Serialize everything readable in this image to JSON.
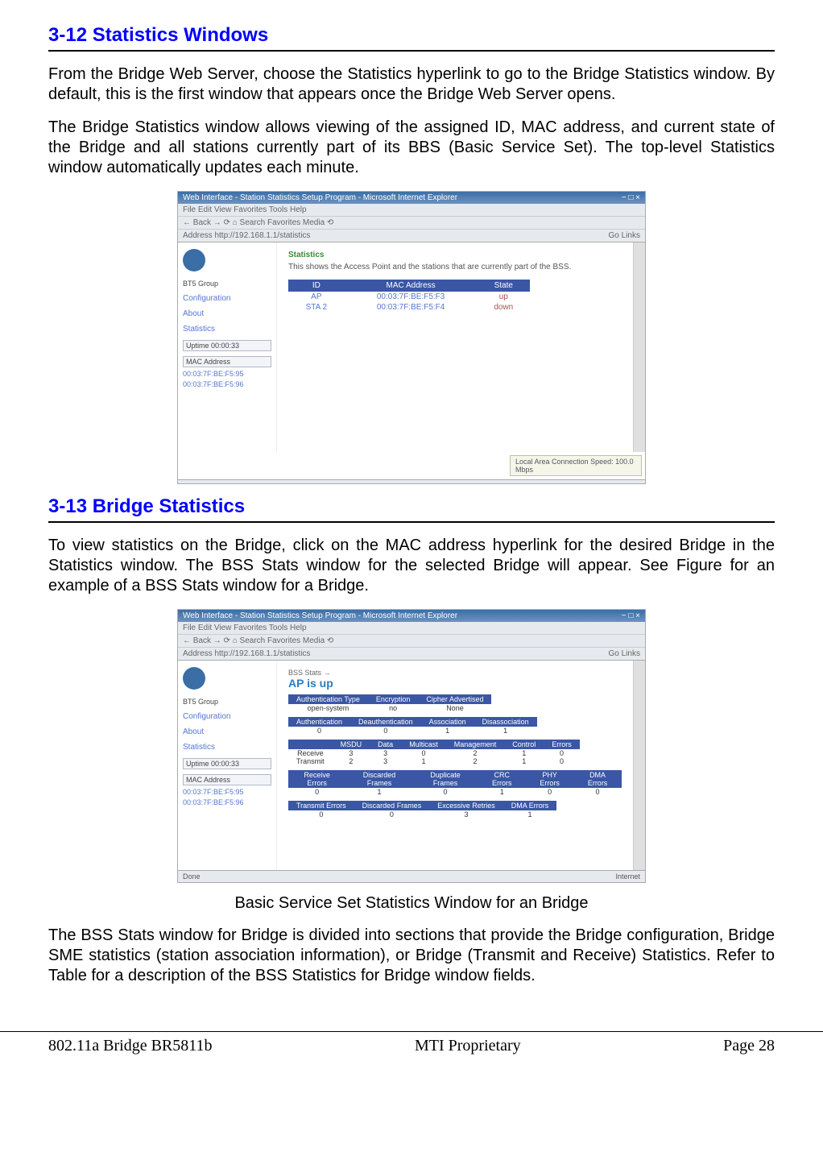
{
  "section1": {
    "title": "3-12 Statistics Windows",
    "para1": "From the Bridge Web Server, choose the Statistics hyperlink to go to the Bridge Statistics window. By default, this is the first window that appears once the Bridge Web Server opens.",
    "para2": "The Bridge Statistics window allows viewing of the assigned ID, MAC address, and current state of the Bridge and all stations currently part of its BBS (Basic Service Set). The top-level Statistics window automatically updates each minute."
  },
  "screenshot1": {
    "titlebar": "Web Interface - Station Statistics Setup Program - Microsoft Internet Explorer",
    "menu": "File   Edit   View   Favorites   Tools   Help",
    "toolbar": "← Back  →  ⟳  ⌂  Search  Favorites  Media  ⟲",
    "addressLabel": "Address",
    "addressValue": "http://192.168.1.1/statistics",
    "goText": "Go   Links",
    "sidebar": {
      "group": "BT5 Group",
      "links": [
        "Configuration",
        "About",
        "Statistics"
      ],
      "uptimeLabel": "Uptime 00:00:33",
      "macHead": "MAC Address",
      "macs": [
        "00:03:7F:BE:F5:95",
        "00:03:7F:BE:F5:96"
      ]
    },
    "content": {
      "heading": "Statistics",
      "desc": "This shows the Access Point and the stations that are currently part of the BSS.",
      "headers": [
        "ID",
        "MAC Address",
        "State"
      ],
      "rows": [
        {
          "id": "AP",
          "mac": "00:03:7F:BE:F5:F3",
          "state": "up"
        },
        {
          "id": "STA 2",
          "mac": "00:03:7F:BE:F5:F4",
          "state": "down"
        }
      ]
    },
    "tray": "Local Area Connection   Speed: 100.0 Mbps",
    "statusLeft": "",
    "statusRight": ""
  },
  "section2": {
    "title": "3-13 Bridge Statistics",
    "para1": "To view statistics on the Bridge, click on the MAC address hyperlink for the desired Bridge in the Statistics window. The BSS Stats window for the selected Bridge will appear. See Figure for an example of a BSS Stats window for a Bridge."
  },
  "screenshot2": {
    "titlebar": "Web Interface - Station Statistics Setup Program - Microsoft Internet Explorer",
    "menu": "File   Edit   View   Favorites   Tools   Help",
    "toolbar": "← Back  →  ⟳  ⌂  Search  Favorites  Media  ⟲",
    "addressLabel": "Address",
    "addressValue": "http://192.168.1.1/statistics",
    "goText": "Go   Links",
    "sidebar": {
      "group": "BT5 Group",
      "links": [
        "Configuration",
        "About",
        "Statistics"
      ],
      "uptimeLabel": "Uptime 00:00:33",
      "macHead": "MAC Address",
      "macs": [
        "00:03:7F:BE:F5:95",
        "00:03:7F:BE:F5:96"
      ]
    },
    "content": {
      "stateLine": "BSS Stats →",
      "apLine": "AP is  up",
      "t1": {
        "headers": [
          "Authentication Type",
          "Encryption",
          "Cipher Advertised"
        ],
        "row": [
          "open-system",
          "no",
          "None"
        ]
      },
      "t2": {
        "headers": [
          "Authentication",
          "Deauthentication",
          "Association",
          "Disassociation"
        ],
        "row": [
          "0",
          "0",
          "1",
          "1"
        ]
      },
      "t3": {
        "headers": [
          "",
          "MSDU",
          "Data",
          "Multicast",
          "Management",
          "Control",
          "Errors"
        ],
        "rows": [
          [
            "Receive",
            "3",
            "3",
            "0",
            "2",
            "1",
            "0"
          ],
          [
            "Transmit",
            "2",
            "3",
            "1",
            "2",
            "1",
            "0"
          ]
        ]
      },
      "t4": {
        "headers": [
          "Receive Errors",
          "Discarded Frames",
          "Duplicate Frames",
          "CRC Errors",
          "PHY Errors",
          "DMA Errors"
        ],
        "row": [
          "0",
          "1",
          "0",
          "1",
          "0",
          "0"
        ]
      },
      "t5": {
        "headers": [
          "Transmit Errors",
          "Discarded Frames",
          "Excessive Retries",
          "DMA Errors"
        ],
        "row": [
          "0",
          "0",
          "3",
          "1"
        ]
      }
    },
    "statusLeft": "Done",
    "statusRight": "Internet"
  },
  "caption2": "Basic Service Set Statistics Window for an Bridge",
  "section2b": {
    "para2": "The BSS Stats window for Bridge is divided into sections that provide the Bridge configuration, Bridge SME statistics (station association information), or Bridge (Transmit and Receive) Statistics. Refer to Table for a description of the BSS Statistics for Bridge window fields."
  },
  "footer": {
    "left": "802.11a Bridge  BR5811b",
    "center": "MTI Proprietary",
    "right": "Page 28"
  }
}
